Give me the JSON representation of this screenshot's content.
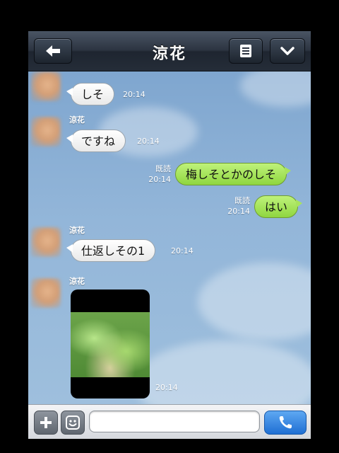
{
  "header": {
    "title": "涼花",
    "back_icon": "back-arrow-icon",
    "menu_icon": "list-icon",
    "collapse_icon": "chevron-down-icon"
  },
  "messages": [
    {
      "sender": "",
      "text": "しそ",
      "time": "20:14",
      "direction": "incoming"
    },
    {
      "sender": "涼花",
      "text": "ですね",
      "time": "20:14",
      "direction": "incoming"
    },
    {
      "read": "既読",
      "text": "梅しそとかのしそ",
      "time": "20:14",
      "direction": "outgoing"
    },
    {
      "read": "既読",
      "text": "はい",
      "time": "20:14",
      "direction": "outgoing"
    },
    {
      "sender": "涼花",
      "text": "仕返しその1",
      "time": "20:14",
      "direction": "incoming"
    },
    {
      "sender": "涼花",
      "image": "shiso-leaves-photo",
      "time": "20:14",
      "direction": "incoming"
    }
  ],
  "input": {
    "placeholder": "",
    "add_icon": "plus-icon",
    "sticker_icon": "smiley-icon",
    "call_icon": "phone-icon"
  },
  "colors": {
    "header": "#2c3441",
    "chat_background": "#8fb3d8",
    "outgoing_bubble": "#9ddc55",
    "incoming_bubble": "#ffffff",
    "call_button": "#2f80e0"
  }
}
